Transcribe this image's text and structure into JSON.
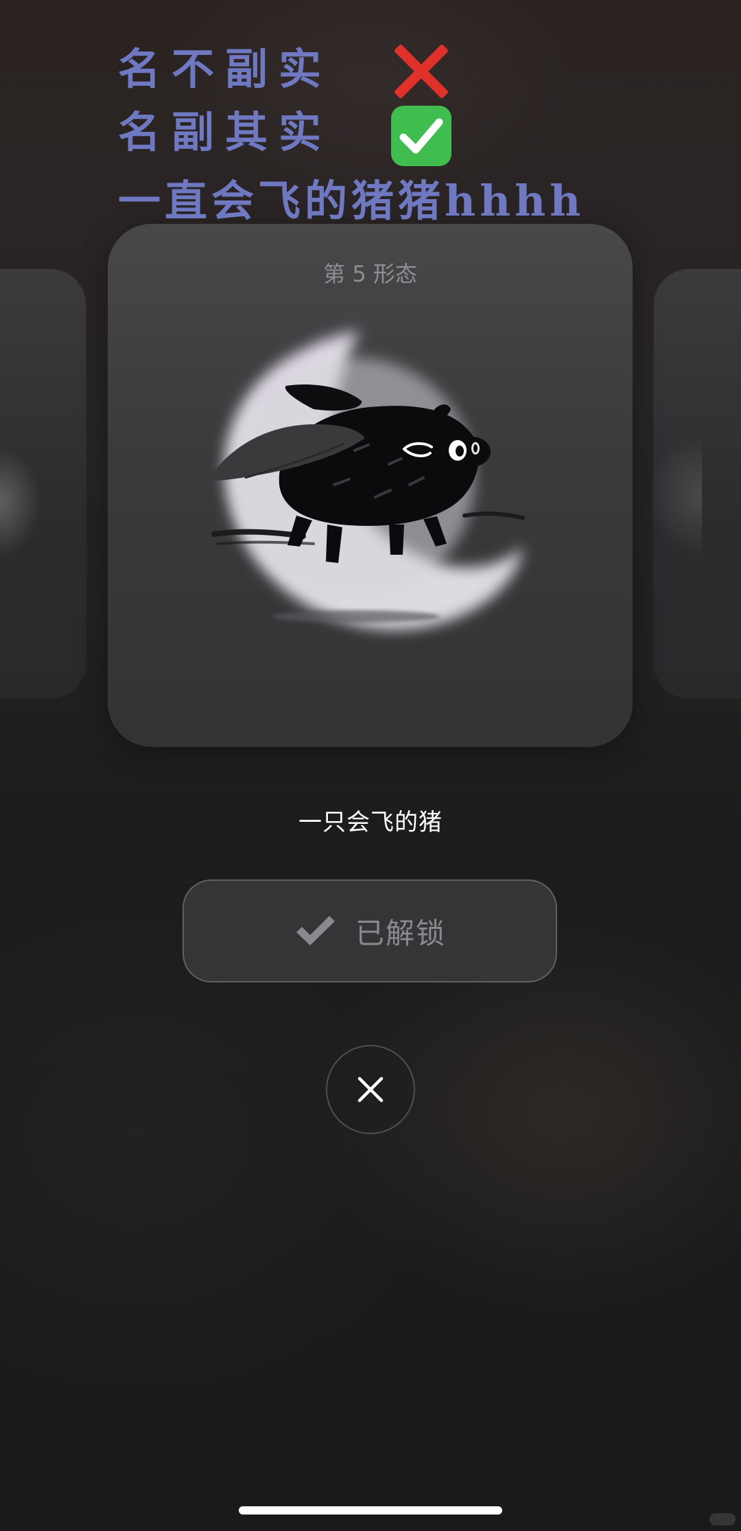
{
  "overlay": {
    "line1": "名不副实",
    "line2": "名副其实",
    "line3": "一直会飞的猪猪hhhh",
    "wrong_mark_icon": "cross-mark-icon",
    "right_mark_icon": "check-box-icon",
    "text_color": "#6f79c2",
    "wrong_color": "#e0312b",
    "right_color": "#3fbe4f"
  },
  "card": {
    "stage_label": "第 5 形态",
    "illustration": "flying-pig-icon"
  },
  "pet": {
    "name": "一只会飞的猪"
  },
  "unlock_button": {
    "icon": "checkmark-icon",
    "label": "已解锁"
  },
  "close_button": {
    "icon": "close-icon"
  }
}
